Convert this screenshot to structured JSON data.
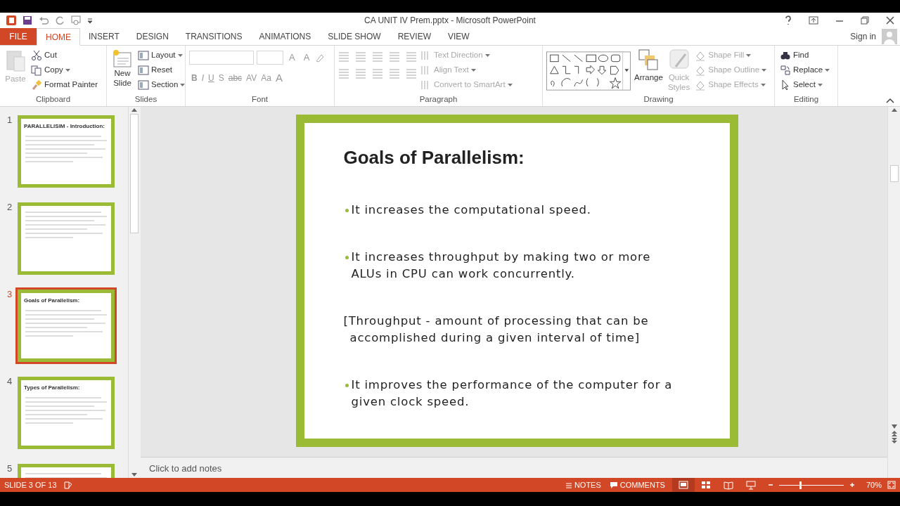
{
  "window": {
    "title": "CA UNIT IV Prem.pptx - Microsoft PowerPoint"
  },
  "account": {
    "label": "Sign in"
  },
  "tabs": [
    {
      "label": "FILE",
      "kind": "file",
      "selected": false
    },
    {
      "label": "HOME",
      "kind": "tab",
      "selected": true
    },
    {
      "label": "INSERT",
      "kind": "tab",
      "selected": false
    },
    {
      "label": "DESIGN",
      "kind": "tab",
      "selected": false
    },
    {
      "label": "TRANSITIONS",
      "kind": "tab",
      "selected": false
    },
    {
      "label": "ANIMATIONS",
      "kind": "tab",
      "selected": false
    },
    {
      "label": "SLIDE SHOW",
      "kind": "tab",
      "selected": false
    },
    {
      "label": "REVIEW",
      "kind": "tab",
      "selected": false
    },
    {
      "label": "VIEW",
      "kind": "tab",
      "selected": false
    }
  ],
  "ribbon": {
    "clipboard": {
      "label": "Clipboard",
      "paste": {
        "label": "Paste",
        "disabled": true
      },
      "items": [
        {
          "label": "Cut",
          "disabled": false
        },
        {
          "label": "Copy",
          "disabled": false
        },
        {
          "label": "Format Painter",
          "disabled": false
        }
      ]
    },
    "slides": {
      "label": "Slides",
      "new_slide": "New",
      "new_slide_2": "Slide",
      "items": [
        {
          "label": "Layout"
        },
        {
          "label": "Reset"
        },
        {
          "label": "Section"
        }
      ]
    },
    "font": {
      "label": "Font",
      "size_buttons": [
        "A",
        "A"
      ],
      "buttons": [
        "B",
        "I",
        "U",
        "S",
        "abc",
        "AV",
        "Aa",
        "A"
      ]
    },
    "paragraph": {
      "label": "Paragraph",
      "items": [
        {
          "label": "Text Direction",
          "disabled": true
        },
        {
          "label": "Align Text",
          "disabled": true
        },
        {
          "label": "Convert to SmartArt",
          "disabled": true
        }
      ]
    },
    "drawing": {
      "label": "Drawing",
      "arrange": {
        "label": "Arrange",
        "disabled": false
      },
      "quick_styles": {
        "label": "Quick",
        "label_2": "Styles",
        "disabled": true
      },
      "items": [
        {
          "label": "Shape Fill",
          "disabled": true
        },
        {
          "label": "Shape Outline",
          "disabled": true
        },
        {
          "label": "Shape Effects",
          "disabled": true
        }
      ]
    },
    "editing": {
      "label": "Editing",
      "items": [
        {
          "label": "Find"
        },
        {
          "label": "Replace"
        },
        {
          "label": "Select"
        }
      ]
    }
  },
  "thumbnails": [
    {
      "number": "1",
      "title": "PARALLELISIM - Introduction:",
      "selected": false
    },
    {
      "number": "2",
      "selected": false
    },
    {
      "number": "3",
      "title": "Goals of Parallelism:",
      "selected": true
    },
    {
      "number": "4",
      "title": "Types of Parallelism:",
      "selected": false
    },
    {
      "number": "5",
      "selected": false
    }
  ],
  "slide": {
    "title": "Goals of Parallelism:",
    "paragraphs": [
      {
        "kind": "bullet",
        "text": "It increases the computational speed."
      },
      {
        "kind": "bullet",
        "text": "It increases throughput by making two or more ALUs in CPU can work concurrently."
      },
      {
        "kind": "plain",
        "text": "[Throughput - amount of processing that can be accomplished during a given interval of time]"
      },
      {
        "kind": "bullet",
        "text": "It improves the performance of the computer for a given clock speed."
      }
    ]
  },
  "notes": {
    "placeholder": "Click to add notes"
  },
  "status_bar": {
    "slide_counter": "SLIDE 3 OF 13",
    "notes": "NOTES",
    "comments": "COMMENTS",
    "views": [
      {
        "kind": "normal",
        "selected": true
      },
      {
        "kind": "sorter",
        "selected": false
      },
      {
        "kind": "reading",
        "selected": false
      },
      {
        "kind": "show",
        "selected": false
      }
    ],
    "zoom": {
      "level": 0.33,
      "reading": "70%"
    }
  }
}
